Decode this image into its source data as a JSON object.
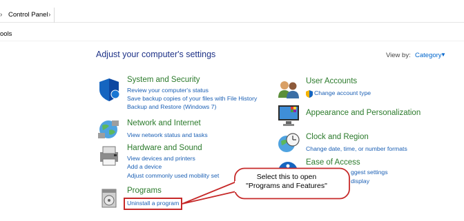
{
  "address_bar": {
    "breadcrumb": "Control Panel",
    "chevron_left": "›",
    "chevron_right": "›"
  },
  "menu": {
    "tools_label": "ools"
  },
  "page": {
    "title": "Adjust your computer's settings",
    "view_by_label": "View by:",
    "view_by_value": "Category",
    "view_by_caret": "▼"
  },
  "categories": [
    {
      "icon": "shield-icon",
      "title": "System and Security",
      "links": [
        "Review your computer's status",
        "Save backup copies of your files with File History",
        "Backup and Restore (Windows 7)"
      ]
    },
    {
      "icon": "network-globe-icon",
      "title": "Network and Internet",
      "links": [
        "View network status and tasks"
      ]
    },
    {
      "icon": "printer-icon",
      "title": "Hardware and Sound",
      "links": [
        "View devices and printers",
        "Add a device",
        "Adjust commonly used mobility set"
      ]
    },
    {
      "icon": "programs-icon",
      "title": "Programs",
      "links": [
        "Uninstall a program"
      ]
    },
    {
      "icon": "users-icon",
      "title": "User Accounts",
      "links": [
        "Change account type"
      ]
    },
    {
      "icon": "monitor-icon",
      "title": "Appearance and Personalization",
      "links": []
    },
    {
      "icon": "clock-globe-icon",
      "title": "Clock and Region",
      "links": [
        "Change date, time, or number formats"
      ]
    },
    {
      "icon": "ease-of-access-icon",
      "title": "Ease of Access",
      "links": [
        "ggest settings",
        "display"
      ]
    }
  ],
  "callout": {
    "line1": "Select this to open",
    "line2": "\"Programs and Features\""
  },
  "colors": {
    "title_green": "#2b7a2b",
    "link_blue": "#1a5fb4",
    "heading_blue": "#1e3287",
    "callout_red": "#c62828",
    "callout_fill": "#ffffff"
  }
}
